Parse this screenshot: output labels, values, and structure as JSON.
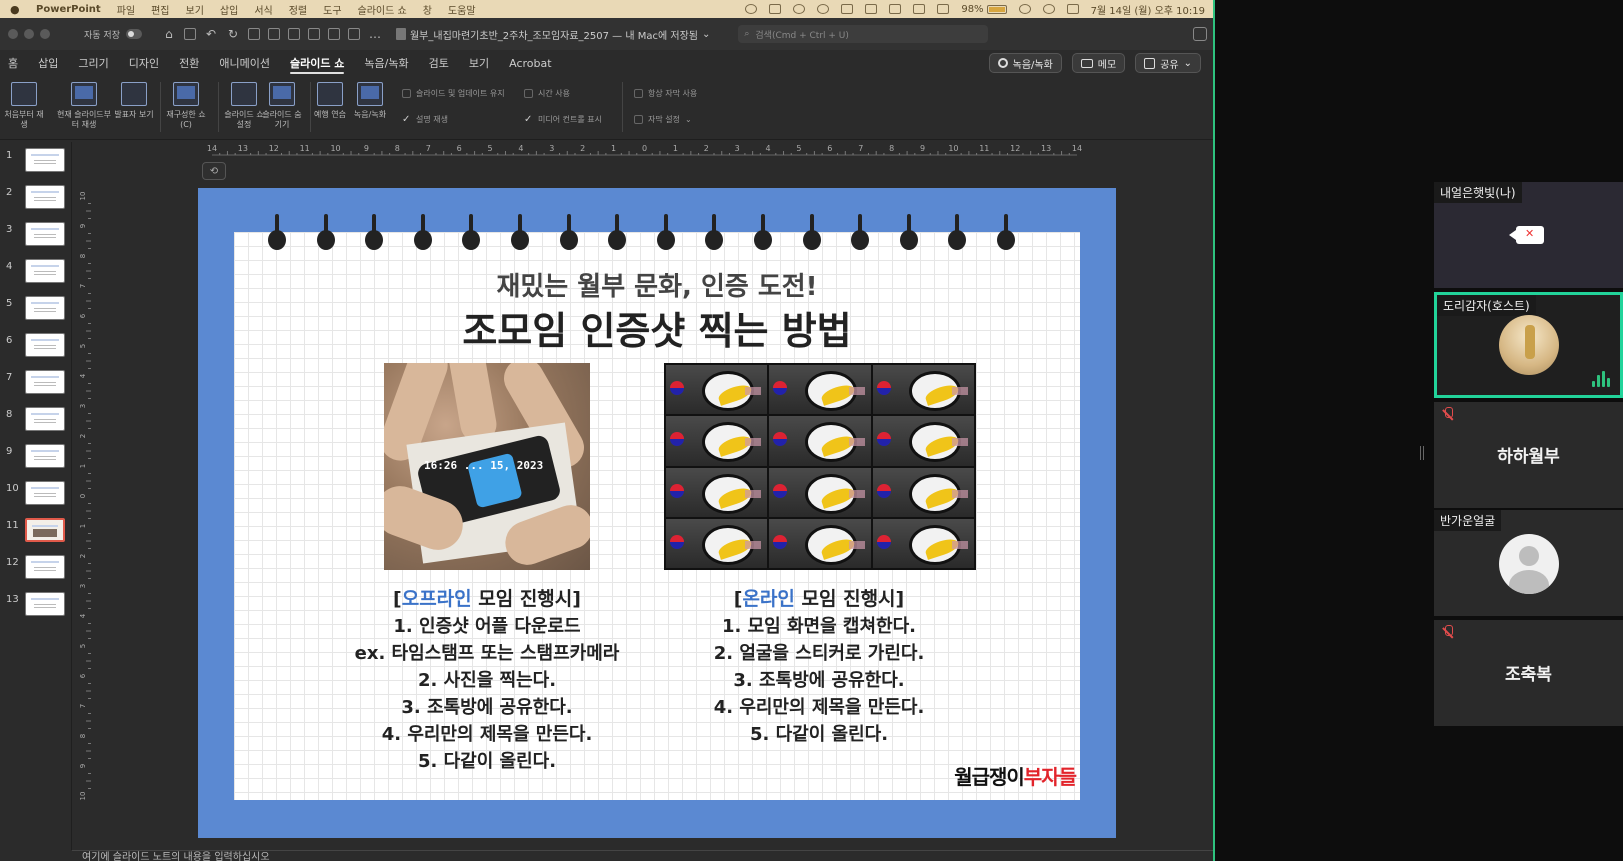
{
  "menubar": {
    "app_name": "PowerPoint",
    "items": [
      "파일",
      "편집",
      "보기",
      "삽입",
      "서식",
      "정렬",
      "도구",
      "슬라이드 쇼",
      "창",
      "도움말"
    ],
    "battery": "98%",
    "datetime": "7월 14일 (월) 오후 10:19"
  },
  "titlebar": {
    "autosave_label": "자동 저장",
    "document_title": "월부_내집마련기초반_2주차_조모임자료_2507 — 내 Mac에 저장됨",
    "search_placeholder": "검색(Cmd + Ctrl + U)"
  },
  "tabs": {
    "items": [
      "홈",
      "삽입",
      "그리기",
      "디자인",
      "전환",
      "애니메이션",
      "슬라이드 쇼",
      "녹음/녹화",
      "검토",
      "보기",
      "Acrobat"
    ],
    "active": "슬라이드 쇼",
    "record_button": "녹음/녹화",
    "memo_button": "메모",
    "share_button": "공유"
  },
  "ribbon": {
    "from_start": "처음부터 재생",
    "from_current": "현재 슬라이드부터 재생",
    "presenter_view": "발표자 보기",
    "custom_show": "재구성한 쇼(C)",
    "setup_show": "슬라이드 쇼 설정",
    "hide_slide": "슬라이드 숨기기",
    "rehearse": "예행 연습",
    "record": "녹음/녹화",
    "keep_updated": "슬라이드 및 업데이트 유지",
    "use_timings": "시간 사용",
    "play_narrations": "설명 재생",
    "show_media_controls": "미디어 컨트롤 표시",
    "always_subtitles": "항상 자막 사용",
    "subtitle_settings": "자막 설정"
  },
  "ruler_top": [
    "14",
    "13",
    "12",
    "11",
    "10",
    "9",
    "8",
    "7",
    "6",
    "5",
    "4",
    "3",
    "2",
    "1",
    "0",
    "1",
    "2",
    "3",
    "4",
    "5",
    "6",
    "7",
    "8",
    "9",
    "10",
    "11",
    "12",
    "13",
    "14"
  ],
  "ruler_left": [
    "10",
    "9",
    "8",
    "7",
    "6",
    "5",
    "4",
    "3",
    "2",
    "1",
    "0",
    "1",
    "2",
    "3",
    "4",
    "5",
    "6",
    "7",
    "8",
    "9",
    "10"
  ],
  "thumbnails": [
    "1",
    "2",
    "3",
    "4",
    "5",
    "6",
    "7",
    "8",
    "9",
    "10",
    "11",
    "12",
    "13"
  ],
  "active_slide": "11",
  "slide": {
    "subtitle": "재밌는 월부 문화, 인증 도전!",
    "title": "조모임 인증샷 찍는 방법",
    "photo_timestamp": "16:26 ... 15, 2023",
    "left_caption": {
      "open": "[",
      "highlight": "오프라인",
      "rest": " 모임 진행시]",
      "lines": [
        "1. 인증샷 어플 다운로드",
        "ex. 타임스탬프 또는 스탬프카메라",
        "2. 사진을 찍는다.",
        "3. 조톡방에 공유한다.",
        "4. 우리만의 제목을 만든다.",
        "5. 다같이 올린다."
      ]
    },
    "right_caption": {
      "open": "[",
      "highlight": "온라인",
      "rest": " 모임 진행시]",
      "lines": [
        "1. 모임 화면을 캡쳐한다.",
        "2. 얼굴을 스티커로 가린다.",
        "3. 조톡방에 공유한다.",
        "4. 우리만의 제목을 만든다.",
        "5. 다같이 올린다."
      ]
    },
    "brand_black": "월급쟁이",
    "brand_red": "부자들"
  },
  "notes_placeholder": "여기에 슬라이드 노트의 내용을 입력하십시오",
  "participants": {
    "p1": "내얼은햇빛(나)",
    "p2": "도리감자(호스트)",
    "p3": "하하월부",
    "p4": "반가운얼굴",
    "p5": "조축복"
  },
  "colors": {
    "slide_frame": "#5b89d2",
    "highlight_blue": "#3a72c8",
    "brand_red": "#e2242b",
    "speaking_border": "#22d39a"
  }
}
